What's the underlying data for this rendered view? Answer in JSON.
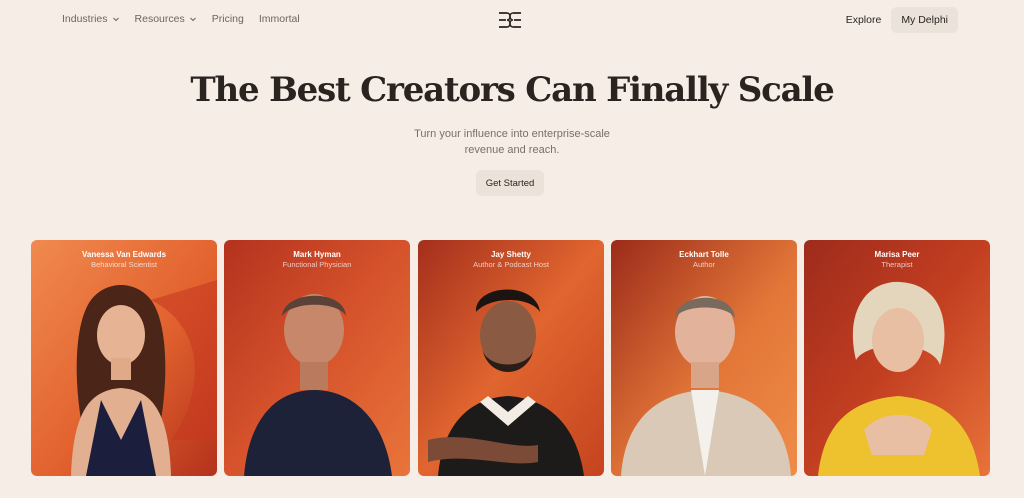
{
  "nav": {
    "items": [
      {
        "label": "Industries",
        "dropdown": true
      },
      {
        "label": "Resources",
        "dropdown": true
      },
      {
        "label": "Pricing",
        "dropdown": false
      },
      {
        "label": "Immortal",
        "dropdown": false
      }
    ],
    "logo_icon": "delphi-logo-icon",
    "explore_label": "Explore",
    "mydelphi_label": "My Delphi"
  },
  "hero": {
    "title": "The Best Creators Can Finally Scale",
    "subtitle": "Turn your influence into enterprise-scale revenue and reach.",
    "cta_label": "Get Started"
  },
  "creators": [
    {
      "name": "Vanessa Van Edwards",
      "role": "Behavioral Scientist"
    },
    {
      "name": "Mark Hyman",
      "role": "Functional Physician"
    },
    {
      "name": "Jay Shetty",
      "role": "Author & Podcast Host"
    },
    {
      "name": "Eckhart Tolle",
      "role": "Author"
    },
    {
      "name": "Marisa Peer",
      "role": "Therapist"
    }
  ],
  "colors": {
    "background": "#f5ede6",
    "button_bg": "#ebe2da",
    "card_red": "#b8331f",
    "card_orange": "#e8612f"
  }
}
